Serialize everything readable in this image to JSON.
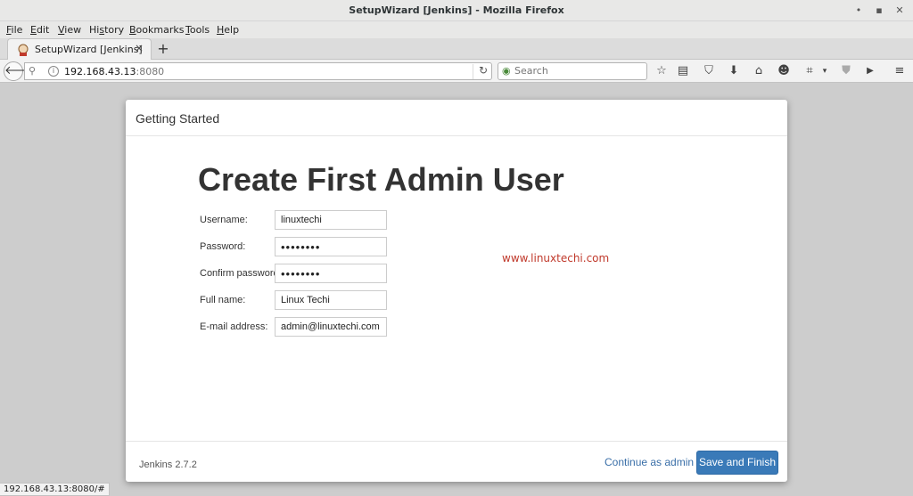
{
  "window": {
    "title": "SetupWizard [Jenkins] - Mozilla Firefox"
  },
  "menu": [
    {
      "pre": "",
      "u": "F",
      "post": "ile"
    },
    {
      "pre": "",
      "u": "E",
      "post": "dit"
    },
    {
      "pre": "",
      "u": "V",
      "post": "iew"
    },
    {
      "pre": "Hi",
      "u": "s",
      "post": "tory"
    },
    {
      "pre": "",
      "u": "B",
      "post": "ookmarks"
    },
    {
      "pre": "",
      "u": "T",
      "post": "ools"
    },
    {
      "pre": "",
      "u": "H",
      "post": "elp"
    }
  ],
  "tab": {
    "title": "SetupWizard [Jenkins]",
    "close": "×"
  },
  "newtab": "+",
  "address": {
    "host": "192.168.43.13",
    "port": ":8080"
  },
  "search": {
    "placeholder": "Search"
  },
  "page": {
    "header": "Getting Started",
    "title": "Create First Admin User",
    "fields": [
      {
        "label": "Username:",
        "value": "linuxtechi",
        "type": "text"
      },
      {
        "label": "Password:",
        "value": "••••••••",
        "type": "password"
      },
      {
        "label": "Confirm password:",
        "value": "••••••••",
        "type": "password"
      },
      {
        "label": "Full name:",
        "value": "Linux Techi",
        "type": "text"
      },
      {
        "label": "E-mail address:",
        "value": "admin@linuxtechi.com",
        "type": "text"
      }
    ],
    "watermark": "www.linuxtechi.com",
    "footer": {
      "version": "Jenkins 2.7.2",
      "continue_label": "Continue as admin",
      "save_label": "Save and Finish"
    }
  },
  "statusbar": "192.168.43.13:8080/#",
  "colors": {
    "accent": "#3a7ab8",
    "link": "#3a6fa8",
    "watermark": "#c0392b"
  }
}
